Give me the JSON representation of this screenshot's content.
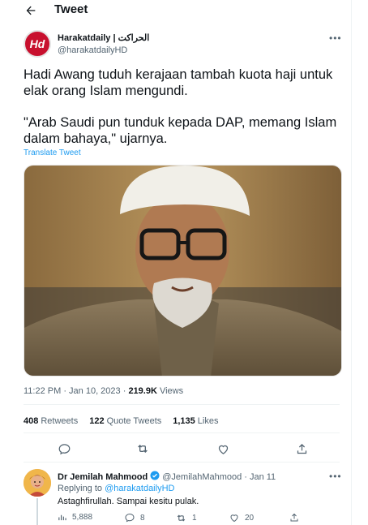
{
  "topbar": {
    "title": "Tweet"
  },
  "author": {
    "avatar_text": "Hd",
    "name": "Harakatdaily | الحراكت",
    "handle": "@harakatdailyHD"
  },
  "tweet": {
    "line1": "Hadi Awang tuduh kerajaan tambah kuota haji untuk elak orang Islam mengundi.",
    "line2": "\"Arab Saudi pun tunduk kepada DAP, memang Islam dalam bahaya,\" ujarnya.",
    "translate": "Translate Tweet",
    "time": "11:22 PM · Jan 10, 2023 · ",
    "views_count": "219.9K",
    "views_label": " Views"
  },
  "stats": {
    "retweets_count": "408",
    "retweets_label": "Retweets",
    "quotes_count": "122",
    "quotes_label": "Quote Tweets",
    "likes_count": "1,135",
    "likes_label": "Likes"
  },
  "reply": {
    "name": "Dr Jemilah Mahmood",
    "handle": "@JemilahMahmood",
    "date": "· Jan 11",
    "replying_prefix": "Replying to ",
    "replying_to": "@harakatdailyHD",
    "text": "Astaghfirullah. Sampai kesitu pulak.",
    "views": "5,888",
    "replies": "8",
    "retweets": "1",
    "likes": "20"
  },
  "colors": {
    "accent": "#1d9bf0",
    "brand": "#c8102e"
  }
}
